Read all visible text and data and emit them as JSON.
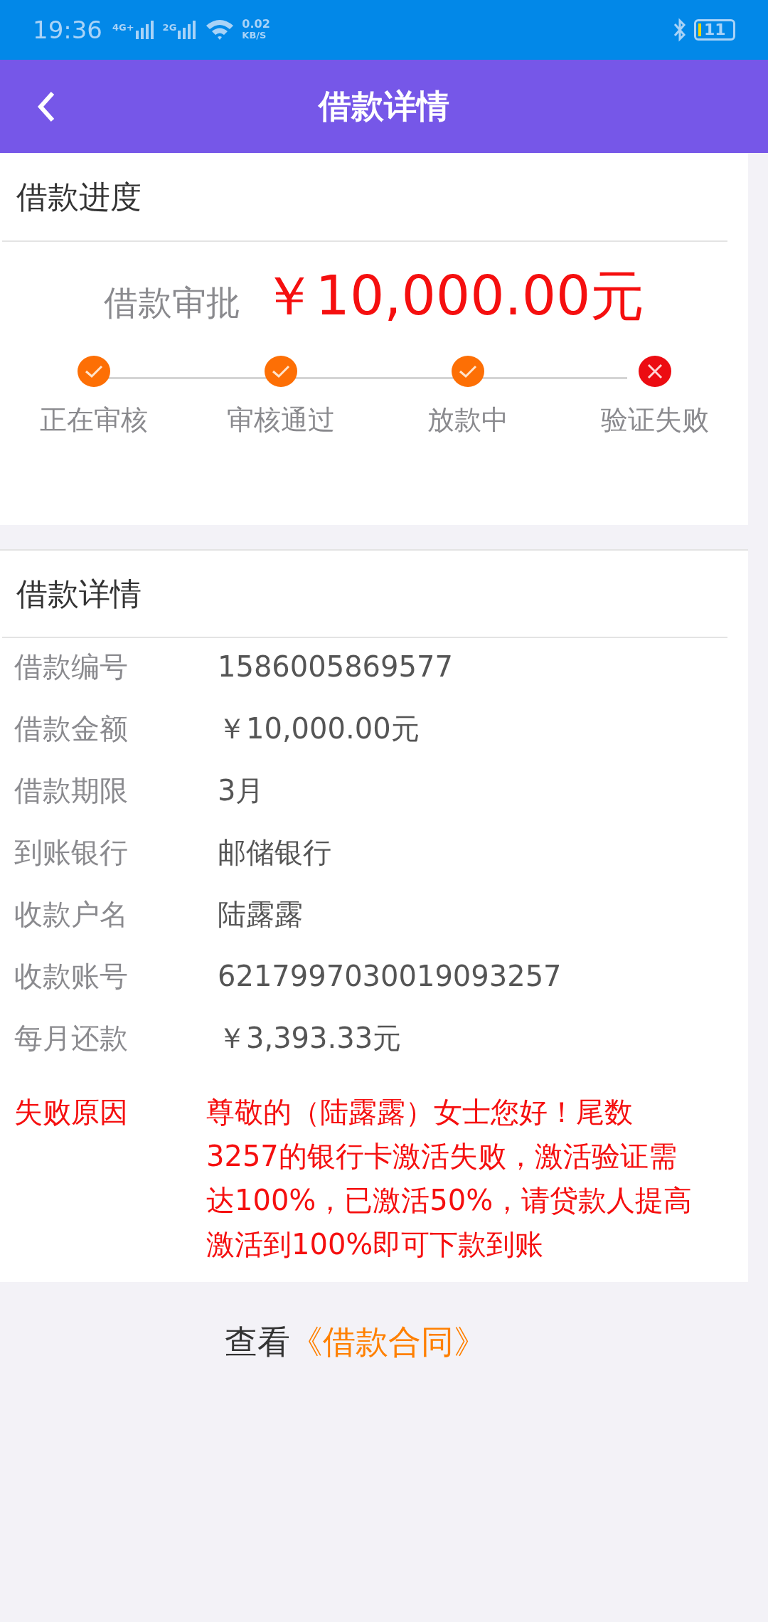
{
  "status_bar": {
    "time": "19:36",
    "net_4g": "4G+",
    "net_2g": "2G",
    "speed_value": "0.02",
    "speed_unit": "KB/S",
    "battery": "11"
  },
  "header": {
    "title": "借款详情"
  },
  "progress": {
    "title": "借款进度",
    "label": "借款审批",
    "amount": "￥10,000.00元",
    "steps": [
      {
        "label": "正在审核",
        "failed": false
      },
      {
        "label": "审核通过",
        "failed": false
      },
      {
        "label": "放款中",
        "failed": false
      },
      {
        "label": "验证失败",
        "failed": true
      }
    ]
  },
  "details": {
    "title": "借款详情",
    "rows": [
      {
        "label": "借款编号",
        "value": "1586005869577",
        "kind": "normal"
      },
      {
        "label": "借款金额",
        "value": "￥10,000.00元",
        "kind": "normal"
      },
      {
        "label": "借款期限",
        "value": "3月",
        "kind": "normal"
      },
      {
        "label": "到账银行",
        "value": "邮储银行",
        "kind": "normal"
      },
      {
        "label": "收款户名",
        "value": "陆露露",
        "kind": "normal"
      },
      {
        "label": "收款账号",
        "value": "6217997030019093257",
        "kind": "normal"
      },
      {
        "label": "每月还款",
        "value": "￥3,393.33元",
        "kind": "normal"
      },
      {
        "label": "失败原因",
        "value": "尊敬的（陆露露）女士您好！尾数3257的银行卡激活失败，激活验证需达100%，已激活50%，请贷款人提高激活到100%即可下款到账",
        "kind": "alert"
      }
    ]
  },
  "contract": {
    "prefix": "查看",
    "link": "《借款合同》"
  }
}
